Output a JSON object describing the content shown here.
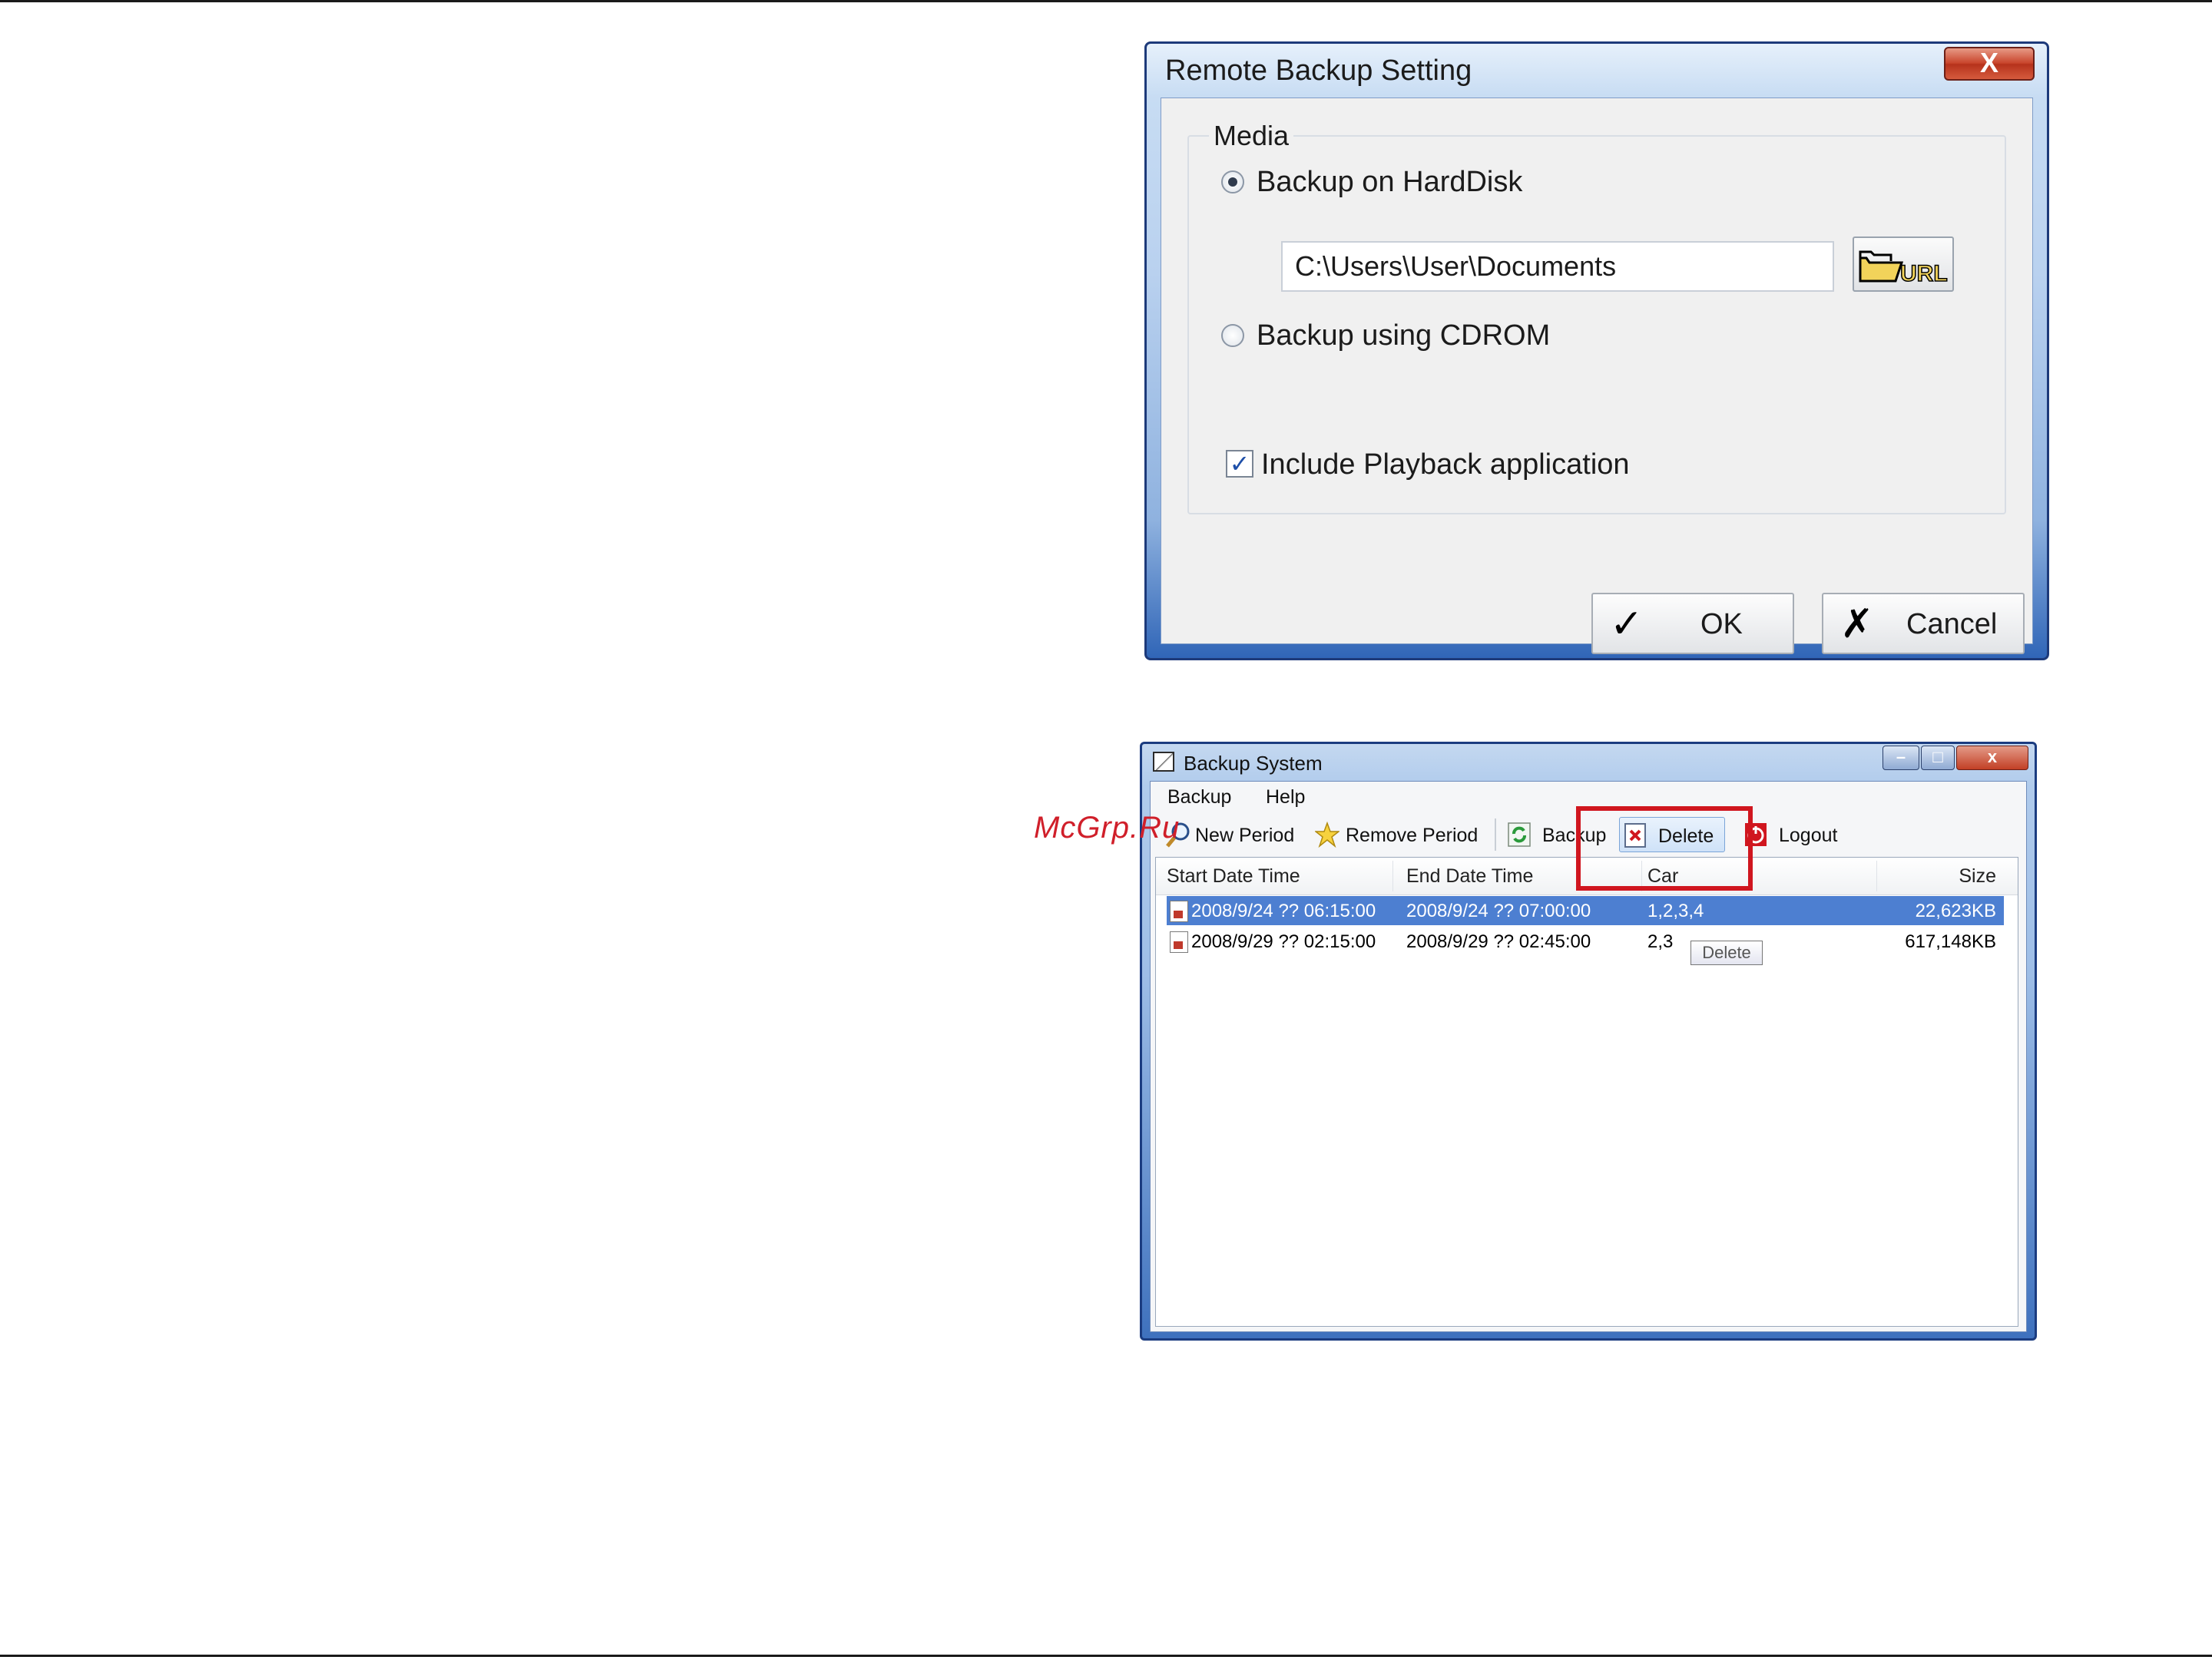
{
  "dialog": {
    "title": "Remote Backup Setting",
    "close_label": "X",
    "media": {
      "legend": "Media",
      "harddisk": {
        "label": "Backup on HardDisk",
        "selected": true
      },
      "path_value": "C:\\Users\\User\\Documents",
      "url_button": "URL",
      "cdrom": {
        "label": "Backup using CDROM",
        "selected": false
      },
      "include_playback": {
        "label": "Include Playback application",
        "checked": true
      }
    },
    "ok_label": "OK",
    "cancel_label": "Cancel"
  },
  "backup_window": {
    "title": "Backup System",
    "menu": [
      "Backup",
      "Help"
    ],
    "toolbar": {
      "new_period": "New Period",
      "remove_period": "Remove Period",
      "backup": "Backup",
      "delete": "Delete",
      "logout": "Logout"
    },
    "tooltip": "Delete",
    "columns": [
      "Start Date Time",
      "End Date Time",
      "Car",
      "Size"
    ],
    "rows": [
      {
        "start": "2008/9/24 ?? 06:15:00",
        "end": "2008/9/24 ?? 07:00:00",
        "cameras": "1,2,3,4",
        "size": "22,623KB",
        "selected": true
      },
      {
        "start": "2008/9/29 ?? 02:15:00",
        "end": "2008/9/29 ?? 02:45:00",
        "cameras": "2,3",
        "size": "617,148KB",
        "selected": false
      }
    ]
  },
  "watermark": "McGrp.Ru",
  "colors": {
    "selection": "#4d7fd1",
    "highlight": "#d0161f",
    "titlebar": "#1d3a7a"
  }
}
